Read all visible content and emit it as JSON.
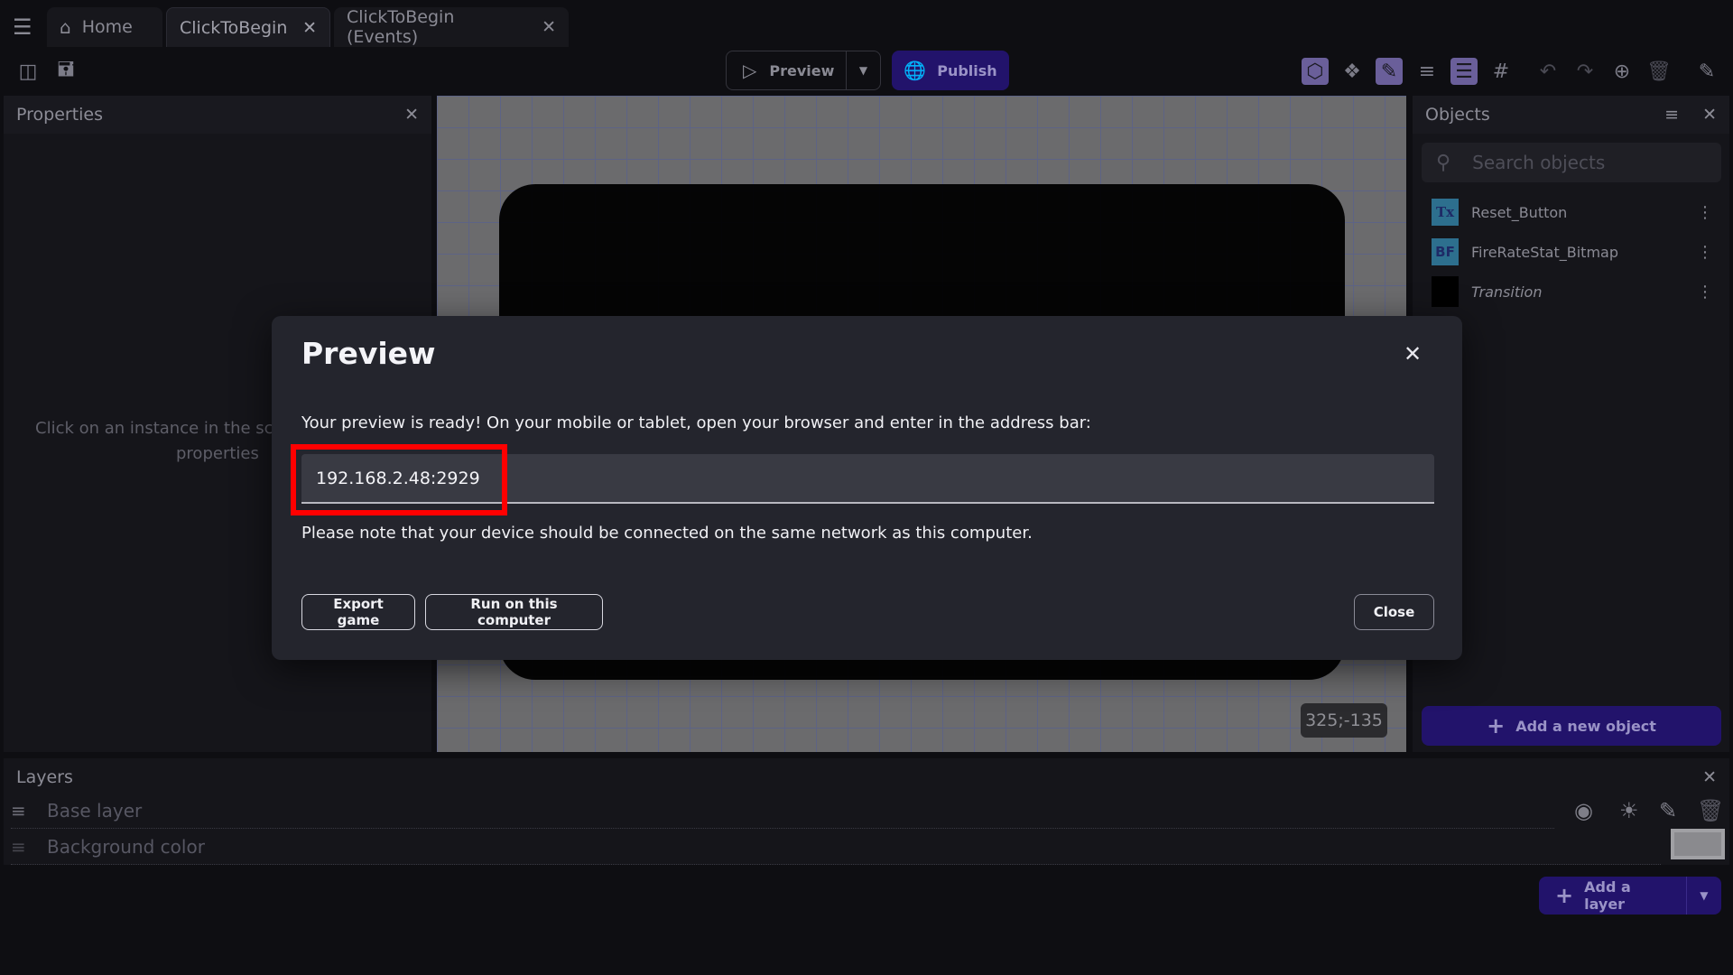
{
  "tabs": [
    {
      "label": "Home",
      "icon": "home-icon"
    },
    {
      "label": "ClickToBegin",
      "active": true
    },
    {
      "label": "ClickToBegin (Events)"
    }
  ],
  "toolbar": {
    "preview_label": "Preview",
    "publish_label": "Publish"
  },
  "properties": {
    "title": "Properties",
    "empty_text_line1": "Click on an instance in the sce",
    "empty_text_line2": "properties"
  },
  "canvas": {
    "coordinates": "325;-135"
  },
  "objects": {
    "title": "Objects",
    "search_placeholder": "Search objects",
    "items": [
      {
        "name": "Reset_Button",
        "icon": "Tx"
      },
      {
        "name": "FireRateStat_Bitmap",
        "icon": "BF"
      },
      {
        "name": "Transition",
        "icon": ""
      }
    ],
    "add_label": "Add a new object"
  },
  "layers": {
    "title": "Layers",
    "rows": [
      {
        "name": "Base layer"
      },
      {
        "name": "Background color"
      }
    ],
    "add_label": "Add a layer"
  },
  "modal": {
    "title": "Preview",
    "message": "Your preview is ready! On your mobile or tablet, open your browser and enter in the address bar:",
    "address": "192.168.2.48:2929",
    "note": "Please note that your device should be connected on the same network as this computer.",
    "export_label": "Export game",
    "run_label": "Run on this computer",
    "close_label": "Close"
  },
  "colors": {
    "accent": "#22136b",
    "highlight": "#ff0000",
    "modal_bg": "#24252d"
  }
}
